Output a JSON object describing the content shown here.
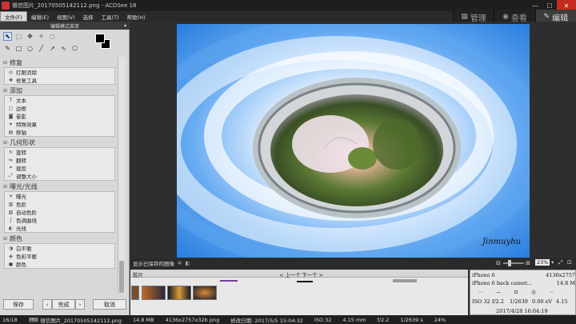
{
  "window": {
    "title": "微信图片_20170505142112.png - ACDSee 18",
    "minimize": "—",
    "maximize": "☐",
    "close": "✕"
  },
  "menu": [
    "文件(F)",
    "编辑(E)",
    "视图(V)",
    "选择",
    "工具(T)",
    "帮助(H)"
  ],
  "modes": [
    {
      "label": "管理",
      "icon": "grid-icon"
    },
    {
      "label": "查看",
      "icon": "eye-icon"
    },
    {
      "label": "编辑",
      "icon": "edit-icon"
    }
  ],
  "panel": {
    "header": "编辑模式菜单",
    "sections": [
      {
        "title": "修复",
        "items": [
          "红眼消除",
          "修复工具"
        ]
      },
      {
        "title": "添加",
        "items": [
          "文本",
          "边框",
          "晕影",
          "特殊效果",
          "移轴"
        ]
      },
      {
        "title": "几何形状",
        "items": [
          "旋转",
          "翻转",
          "裁剪",
          "调整大小"
        ]
      },
      {
        "title": "曝光/光线",
        "items": [
          "曝光",
          "色阶",
          "自动色阶",
          "色调曲线",
          "光线"
        ]
      },
      {
        "title": "颜色",
        "items": [
          "白平衡",
          "色彩平衡",
          "颜色"
        ]
      }
    ],
    "save": "保存",
    "done": "完成",
    "prev_arrow": "‹",
    "next_arrow": "›",
    "cancel": "取消"
  },
  "viewer": {
    "caption": "显示已保存的图像",
    "zoom": "23%",
    "watermark": "Jinmuyhu"
  },
  "filmstrip": {
    "label": "胶片",
    "prev": "< 上一个",
    "next": "下一个 >"
  },
  "info": {
    "camera": "iPhone 6",
    "dimensions": "4136x2757",
    "lens": "iPhone 6 back camer...",
    "size": "14.8 M",
    "aperture": "f/2.2",
    "shutter": "1/2639",
    "ev": "0.00 eV",
    "focal": "4.15",
    "iso": "ISO 32",
    "datetime": "2017/4/28 16:04:19"
  },
  "status": {
    "index": "16/18",
    "filename": "微信图片_20170505142112.png",
    "filesize": "14.8 MB",
    "imageinfo": "4136x2757x32b png",
    "modified": "修改日期: 2017/5/5 15:04:32",
    "iso": "ISO 32",
    "focal": "4.15 mm",
    "aperture": "f/2.2",
    "shutter": "1/2639 s",
    "zoom": "24%"
  },
  "colors": {
    "accent": "#3c7fd6",
    "sky": "#3f8fe6",
    "close": "#c42b1c"
  }
}
